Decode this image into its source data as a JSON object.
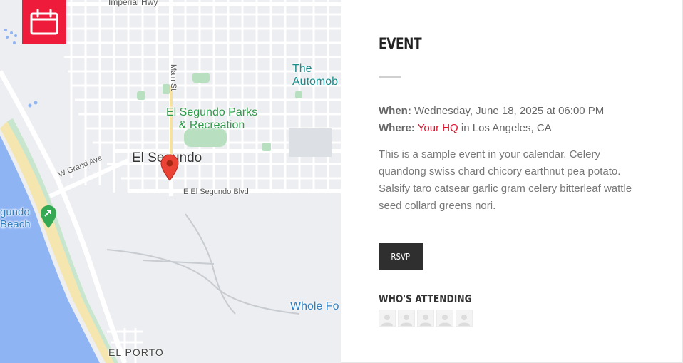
{
  "map": {
    "labels": {
      "highway": "Imperial Hwy",
      "main_st": "Main St",
      "automob": "The\nAutomob",
      "parks": "El Segundo Parks\n& Recreation",
      "city": "El Segundo",
      "grand_ave": "W Grand Ave",
      "blvd": "E El Segundo Blvd",
      "beach": "gundo\nBeach",
      "whole": "Whole Fo",
      "porto": "EL PORTO"
    },
    "colors": {
      "pin": "#ea4335",
      "water": "#8fb4f4",
      "sand": "#f5e6b0",
      "park": "#b8e0c0"
    }
  },
  "badge": {
    "icon": "calendar-icon",
    "color": "#ee1c3a"
  },
  "event": {
    "title": "EVENT",
    "when_label": "When:",
    "when_value": "Wednesday, June 18, 2025 at 06:00 PM",
    "where_label": "Where:",
    "where_place": "Your HQ",
    "where_suffix": "in Los Angeles, CA",
    "description": "This is a sample event in your calendar. Celery quandong swiss chard chicory earthnut pea potato. Salsify taro catsear garlic gram celery bitterleaf wattle seed collard greens nori.",
    "rsvp_label": "RSVP",
    "attending_title": "WHO'S ATTENDING",
    "attendees": [
      {
        "icon": "person-icon"
      },
      {
        "icon": "person-icon"
      },
      {
        "icon": "person-icon"
      },
      {
        "icon": "person-icon"
      },
      {
        "icon": "person-icon"
      }
    ],
    "accent_color": "#e0112b"
  }
}
